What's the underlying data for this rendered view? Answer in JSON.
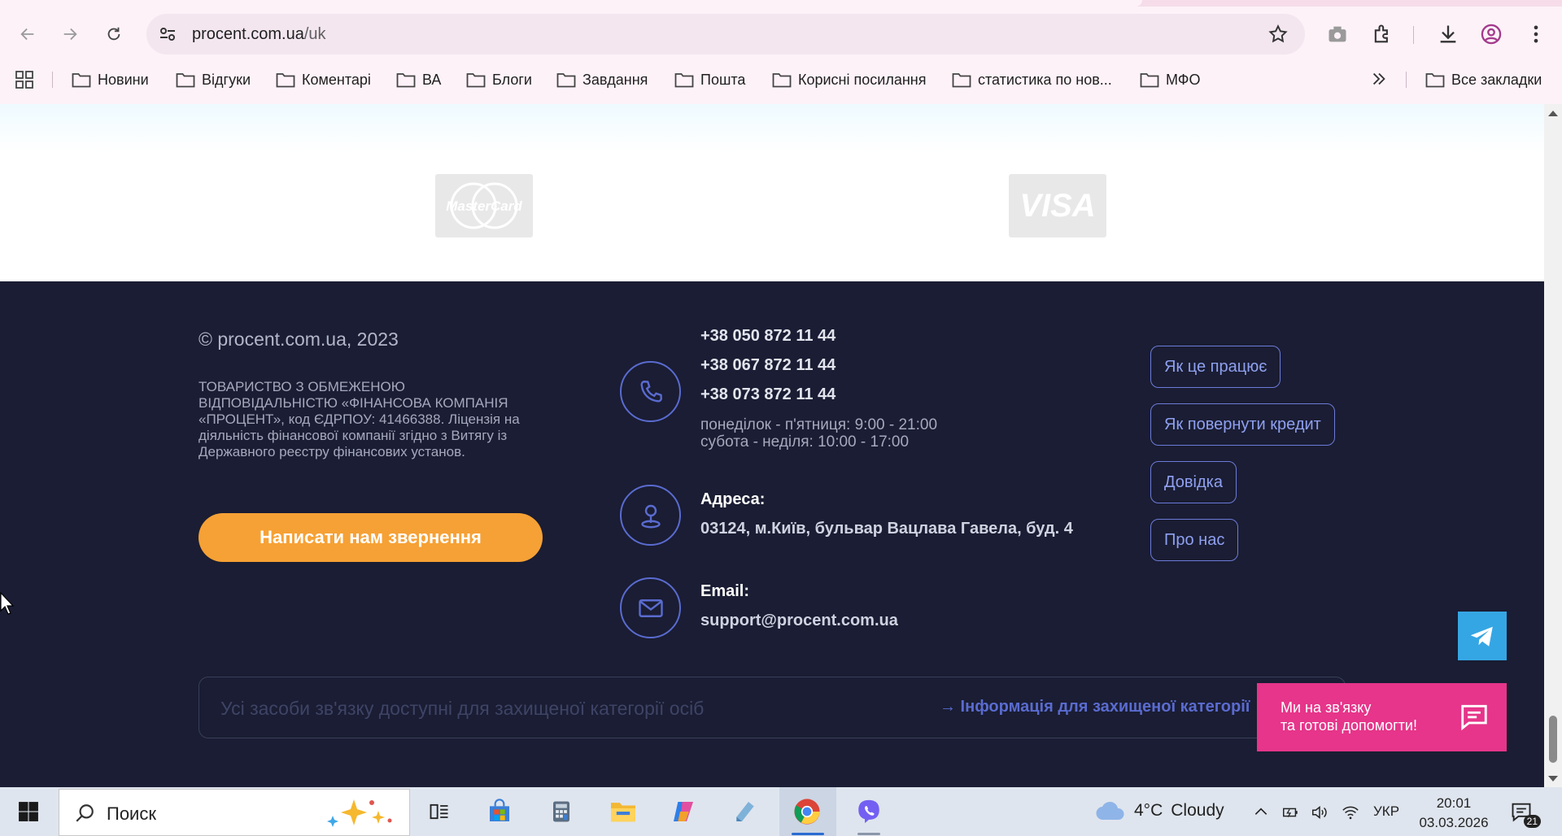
{
  "browser": {
    "url_domain": "procent.com.ua",
    "url_path": "/uk",
    "bookmarks": [
      {
        "label": "Новини"
      },
      {
        "label": "Відгуки"
      },
      {
        "label": "Коментарі"
      },
      {
        "label": "ВА"
      },
      {
        "label": "Блоги"
      },
      {
        "label": "Завдання"
      },
      {
        "label": "Пошта"
      },
      {
        "label": "Корисні посилання"
      },
      {
        "label": "статистика по нов..."
      },
      {
        "label": "МФО"
      }
    ],
    "all_bookmarks_label": "Все закладки"
  },
  "payments": {
    "mastercard_label": "MasterCard",
    "visa_label": "VISA"
  },
  "footer": {
    "copyright": "© procent.com.ua, 2023",
    "legal_text": "ТОВАРИСТВО З ОБМЕЖЕНОЮ ВІДПОВІДАЛЬНІСТЮ «ФІНАНСОВА КОМПАНІЯ «ПРОЦЕНТ», код ЄДРПОУ: 41466388. Ліцензія на діяльність фінансової компанії згідно з Витягу із Державного реєстру фінансових установ.",
    "cta_button": "Написати нам звернення",
    "phones": [
      "+38 050 872 11 44",
      "+38 067 872 11 44",
      "+38 073 872 11 44"
    ],
    "hours_weekdays": "понеділок - п'ятниця: 9:00 - 21:00",
    "hours_weekend": "субота - неділя: 10:00 - 17:00",
    "address_label": "Адреса:",
    "address_value": "03124, м.Київ, бульвар Вацлава Гавела, буд. 4",
    "email_label": "Email:",
    "email_value": "support@procent.com.ua",
    "links": [
      "Як це працює",
      "Як повернути кредит",
      "Довідка",
      "Про нас"
    ],
    "notice_text": "Усі засоби зв'язку доступні для захищеної категорії осіб",
    "notice_link": "→ Інформація для захищеної категорії"
  },
  "chat_widget": {
    "line1": "Ми на зв'язку",
    "line2": "та готові допомогти!"
  },
  "taskbar": {
    "search_placeholder": "Поиск",
    "weather_temp": "4°C",
    "weather_desc": "Cloudy",
    "language": "УКР",
    "time": "20:01",
    "date": "03.03.2026",
    "notification_count": "21"
  },
  "colors": {
    "footer_bg": "#1a1d33",
    "accent_orange": "#f6a135",
    "accent_blue": "#5a6bd0",
    "chat_pink": "#e6358a",
    "telegram_blue": "#35a6e4"
  }
}
